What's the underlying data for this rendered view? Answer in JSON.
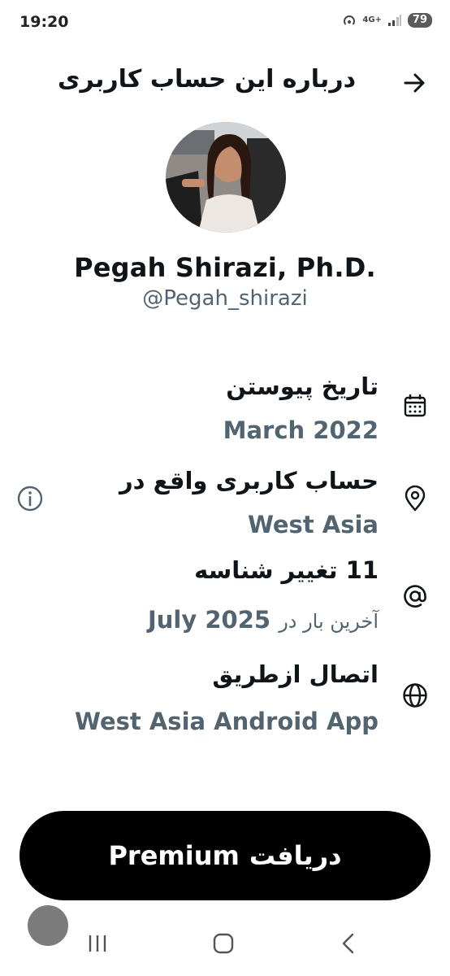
{
  "status_bar": {
    "time": "19:20",
    "network": "4G+",
    "battery": "79"
  },
  "header": {
    "title": "درباره این حساب کاربری",
    "back_icon": "arrow-right-icon"
  },
  "profile": {
    "name": "Pegah Shirazi, Ph.D.",
    "handle": "@Pegah_shirazi"
  },
  "info": {
    "joined": {
      "title": "تاریخ پیوستن",
      "value": "March 2022",
      "icon": "calendar-icon"
    },
    "location": {
      "title": "حساب کاربری واقع در",
      "value": "West Asia",
      "icon": "location-pin-icon"
    },
    "handle_changes": {
      "count": "11",
      "title": "تغییر شناسه",
      "last_prefix": "آخرین بار در",
      "last_value": "July 2025",
      "icon": "at-icon"
    },
    "connected_via": {
      "title": "اتصال ازطریق",
      "value": "West Asia Android App",
      "icon": "globe-icon"
    }
  },
  "premium": {
    "prefix": "دریافت",
    "label": "Premium"
  },
  "colors": {
    "primary_text": "#0f1419",
    "secondary_text": "#536471",
    "button_bg": "#000000"
  }
}
